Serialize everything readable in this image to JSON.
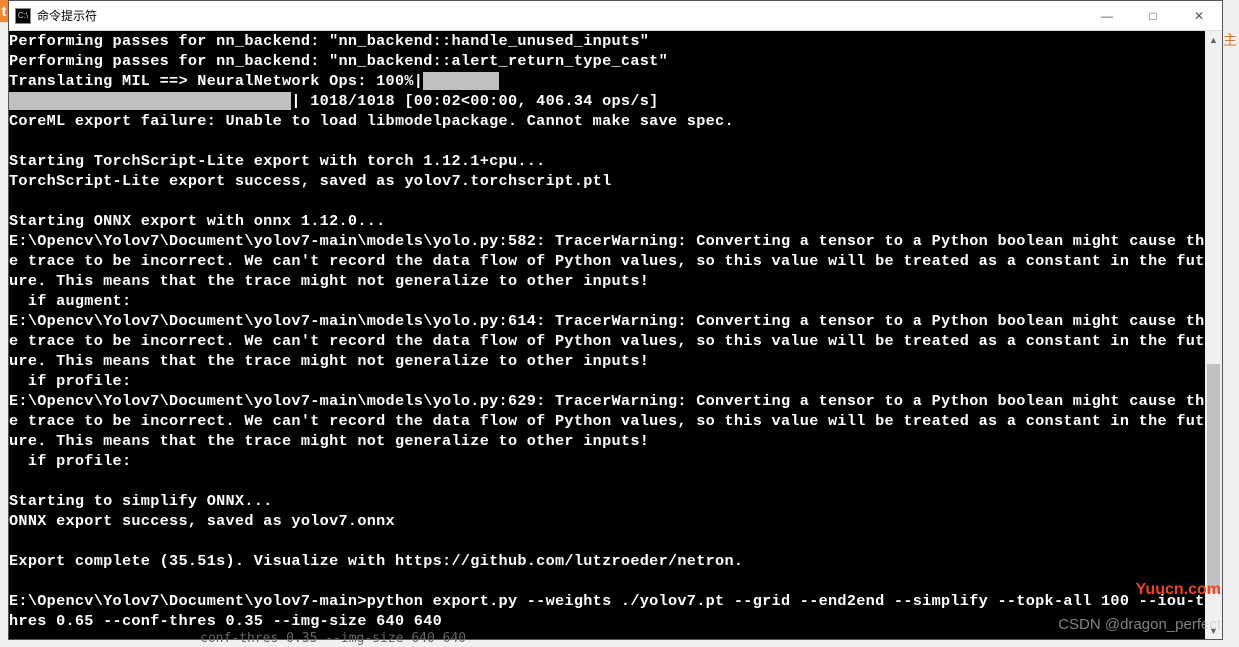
{
  "window": {
    "title": "命令提示符",
    "icon_label": "C:\\"
  },
  "controls": {
    "minimize": "—",
    "maximize": "□",
    "close": "✕"
  },
  "terminal": {
    "lines": [
      {
        "t": "Performing passes for nn_backend: \"nn_backend::handle_unused_inputs\""
      },
      {
        "t": "Performing passes for nn_backend: \"nn_backend::alert_return_type_cast\""
      },
      {
        "t": "Translating MIL ==> NeuralNetwork Ops: 100%|",
        "progressPrefix": true
      },
      {
        "t": " 1018/1018 [00:02<00:00, 406.34 ops/s]",
        "progressBar": true
      },
      {
        "t": "CoreML export failure: Unable to load libmodelpackage. Cannot make save spec."
      },
      {
        "t": ""
      },
      {
        "t": "Starting TorchScript-Lite export with torch 1.12.1+cpu..."
      },
      {
        "t": "TorchScript-Lite export success, saved as yolov7.torchscript.ptl"
      },
      {
        "t": ""
      },
      {
        "t": "Starting ONNX export with onnx 1.12.0..."
      },
      {
        "t": "E:\\Opencv\\Yolov7\\Document\\yolov7-main\\models\\yolo.py:582: TracerWarning: Converting a tensor to a Python boolean might cause the trace to be incorrect. We can't record the data flow of Python values, so this value will be treated as a constant in the future. This means that the trace might not generalize to other inputs!"
      },
      {
        "t": "  if augment:"
      },
      {
        "t": "E:\\Opencv\\Yolov7\\Document\\yolov7-main\\models\\yolo.py:614: TracerWarning: Converting a tensor to a Python boolean might cause the trace to be incorrect. We can't record the data flow of Python values, so this value will be treated as a constant in the future. This means that the trace might not generalize to other inputs!"
      },
      {
        "t": "  if profile:"
      },
      {
        "t": "E:\\Opencv\\Yolov7\\Document\\yolov7-main\\models\\yolo.py:629: TracerWarning: Converting a tensor to a Python boolean might cause the trace to be incorrect. We can't record the data flow of Python values, so this value will be treated as a constant in the future. This means that the trace might not generalize to other inputs!"
      },
      {
        "t": "  if profile:"
      },
      {
        "t": ""
      },
      {
        "t": "Starting to simplify ONNX..."
      },
      {
        "t": "ONNX export success, saved as yolov7.onnx"
      },
      {
        "t": ""
      },
      {
        "t": "Export complete (35.51s). Visualize with https://github.com/lutzroeder/netron."
      },
      {
        "t": ""
      },
      {
        "t": "E:\\Opencv\\Yolov7\\Document\\yolov7-main>python export.py --weights ./yolov7.pt --grid --end2end --simplify --topk-all 100 --iou-thres 0.65 --conf-thres 0.35 --img-size 640 640"
      }
    ],
    "progress_fill_cols": 30
  },
  "watermarks": {
    "url": "Yuucn.com",
    "csdn": "CSDN @dragon_perfect",
    "right_char": "主"
  },
  "shadow_text": "conf-thres 0.35 --img-size 640 640"
}
